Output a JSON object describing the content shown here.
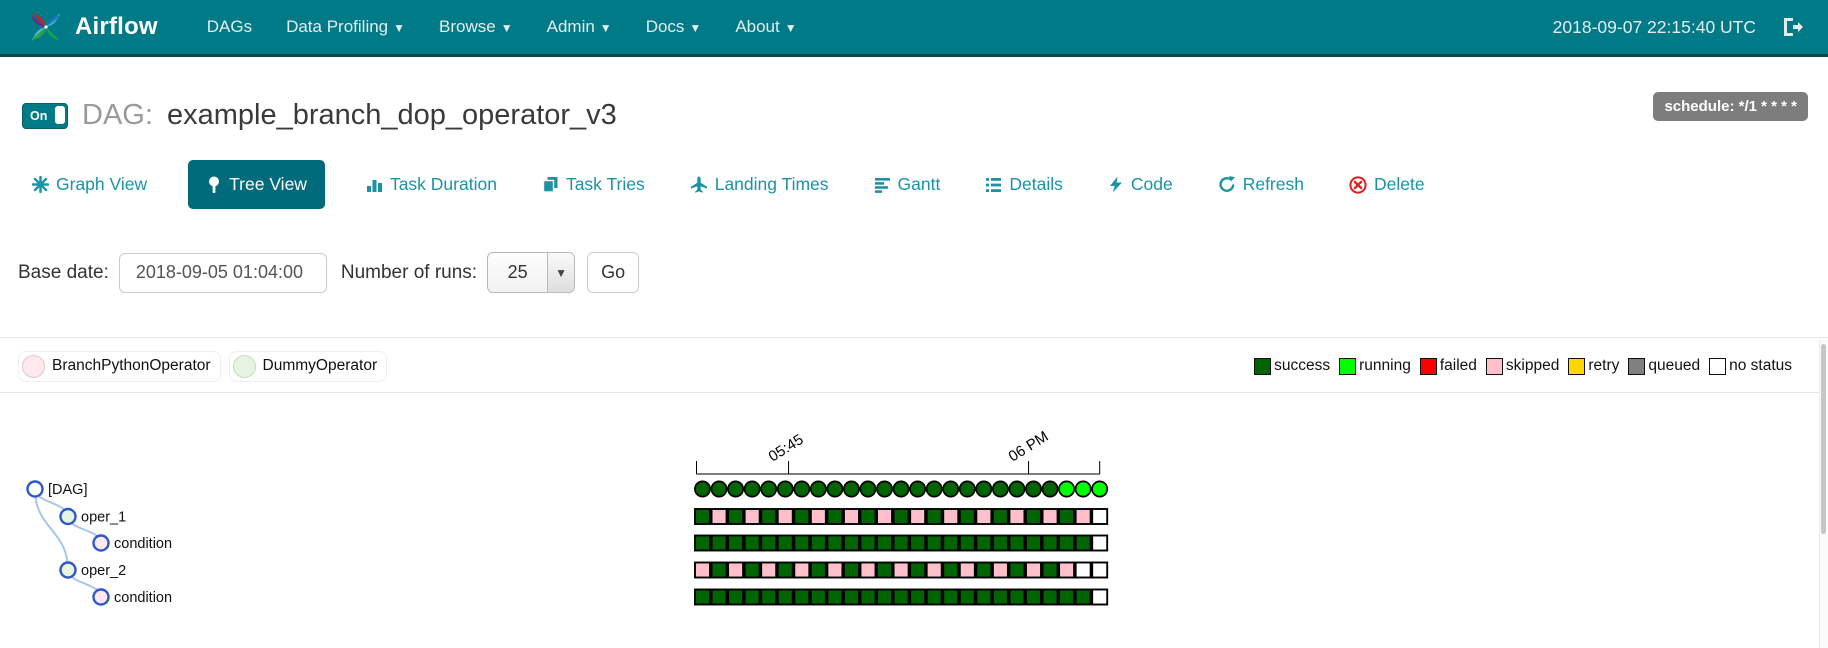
{
  "navbar": {
    "brand": "Airflow",
    "items": [
      {
        "label": "DAGs",
        "caret": false
      },
      {
        "label": "Data Profiling",
        "caret": true
      },
      {
        "label": "Browse",
        "caret": true
      },
      {
        "label": "Admin",
        "caret": true
      },
      {
        "label": "Docs",
        "caret": true
      },
      {
        "label": "About",
        "caret": true
      }
    ],
    "clock": "2018-09-07 22:15:40 UTC"
  },
  "header": {
    "toggle_label": "On",
    "dag_prefix": "DAG:",
    "dag_name": "example_branch_dop_operator_v3",
    "schedule_badge": "schedule: */1 * * * *"
  },
  "tabs": [
    {
      "label": "Graph View",
      "active": false
    },
    {
      "label": "Tree View",
      "active": true
    },
    {
      "label": "Task Duration",
      "active": false
    },
    {
      "label": "Task Tries",
      "active": false
    },
    {
      "label": "Landing Times",
      "active": false
    },
    {
      "label": "Gantt",
      "active": false
    },
    {
      "label": "Details",
      "active": false
    },
    {
      "label": "Code",
      "active": false
    },
    {
      "label": "Refresh",
      "active": false
    },
    {
      "label": "Delete",
      "active": false
    }
  ],
  "controls": {
    "base_date_label": "Base date:",
    "base_date_value": "2018-09-05 01:04:00",
    "num_runs_label": "Number of runs:",
    "num_runs_value": "25",
    "go_label": "Go"
  },
  "legend": {
    "operators": [
      {
        "name": "BranchPythonOperator",
        "fill": "#ffe8ee",
        "border": "#e2c6cc"
      },
      {
        "name": "DummyOperator",
        "fill": "#e6f4e1",
        "border": "#c6dcc0"
      }
    ],
    "statuses": [
      {
        "label": "success",
        "color": "#006400"
      },
      {
        "label": "running",
        "color": "#00ff00"
      },
      {
        "label": "failed",
        "color": "#ff0000"
      },
      {
        "label": "skipped",
        "color": "#ffc0cb"
      },
      {
        "label": "retry",
        "color": "#ffd700"
      },
      {
        "label": "queued",
        "color": "#808080"
      },
      {
        "label": "no status",
        "color": "#ffffff"
      }
    ]
  },
  "chart_data": {
    "type": "heatmap",
    "title": "",
    "num_runs": 25,
    "axis_ticks": [
      {
        "label": "05:45",
        "at_run": 5.2
      },
      {
        "label": "06 PM",
        "at_run": 19.7
      }
    ],
    "state_colors": {
      "success": "#006400",
      "running": "#00ff00",
      "failed": "#ff0000",
      "skipped": "#ffc0cb",
      "retry": "#ffd700",
      "queued": "#808080",
      "no_status": "#ffffff"
    },
    "node_fills": {
      "dag": "#ffffff",
      "dummy": "#e6f4e1",
      "branch": "#ffe8ee"
    },
    "dag_run_states": [
      "success",
      "success",
      "success",
      "success",
      "success",
      "success",
      "success",
      "success",
      "success",
      "success",
      "success",
      "success",
      "success",
      "success",
      "success",
      "success",
      "success",
      "success",
      "success",
      "success",
      "success",
      "success",
      "running",
      "running",
      "running"
    ],
    "tasks": [
      {
        "name": "oper_1",
        "states": [
          "success",
          "skipped",
          "success",
          "skipped",
          "success",
          "skipped",
          "success",
          "skipped",
          "success",
          "skipped",
          "success",
          "skipped",
          "success",
          "skipped",
          "success",
          "skipped",
          "success",
          "skipped",
          "success",
          "skipped",
          "success",
          "skipped",
          "success",
          "skipped",
          "no_status"
        ]
      },
      {
        "name": "condition",
        "states": [
          "success",
          "success",
          "success",
          "success",
          "success",
          "success",
          "success",
          "success",
          "success",
          "success",
          "success",
          "success",
          "success",
          "success",
          "success",
          "success",
          "success",
          "success",
          "success",
          "success",
          "success",
          "success",
          "success",
          "success",
          "no_status"
        ]
      },
      {
        "name": "oper_2",
        "states": [
          "skipped",
          "success",
          "skipped",
          "success",
          "skipped",
          "success",
          "skipped",
          "success",
          "skipped",
          "success",
          "skipped",
          "success",
          "skipped",
          "success",
          "skipped",
          "success",
          "skipped",
          "success",
          "skipped",
          "success",
          "skipped",
          "success",
          "skipped",
          "no_status",
          "no_status"
        ]
      },
      {
        "name": "condition",
        "states": [
          "success",
          "success",
          "success",
          "success",
          "success",
          "success",
          "success",
          "success",
          "success",
          "success",
          "success",
          "success",
          "success",
          "success",
          "success",
          "success",
          "success",
          "success",
          "success",
          "success",
          "success",
          "success",
          "success",
          "success",
          "no_status"
        ]
      }
    ],
    "tree": {
      "label": "[DAG]",
      "type": "dag",
      "children": [
        {
          "label": "oper_1",
          "type": "dummy",
          "children": [
            {
              "label": "condition",
              "type": "branch",
              "children": []
            }
          ]
        },
        {
          "label": "oper_2",
          "type": "dummy",
          "children": [
            {
              "label": "condition",
              "type": "branch",
              "children": []
            }
          ]
        }
      ]
    }
  }
}
